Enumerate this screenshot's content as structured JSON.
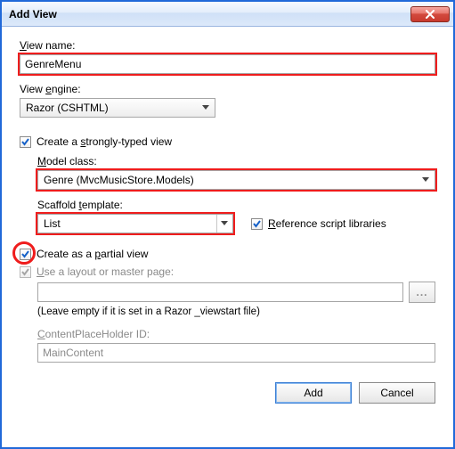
{
  "title": "Add View",
  "labels": {
    "view_name": "View name:",
    "view_name_u": "V",
    "view_engine": "View engine:",
    "view_engine_u": "e",
    "strongly_typed": "Create a strongly-typed view",
    "strongly_typed_u": "s",
    "model_class": "Model class:",
    "model_class_u": "M",
    "scaffold_template": "Scaffold template:",
    "scaffold_template_u": "t",
    "partial_view": "Create as a partial view",
    "partial_view_u": "p",
    "use_layout": "Use a layout or master page:",
    "use_layout_u": "U",
    "ref_scripts": "Reference script libraries",
    "ref_scripts_u": "R",
    "hint": "(Leave empty if it is set in a Razor _viewstart file)",
    "cph_id": "ContentPlaceHolder ID:",
    "cph_id_u": "C",
    "add": "Add",
    "cancel": "Cancel"
  },
  "values": {
    "view_name": "GenreMenu",
    "view_engine": "Razor (CSHTML)",
    "model_class": "Genre (MvcMusicStore.Models)",
    "scaffold_template": "List",
    "layout_path": "",
    "cph_id": "MainContent"
  },
  "checks": {
    "strongly_typed": true,
    "ref_scripts": true,
    "partial_view": true,
    "use_layout": true
  },
  "buttons": {
    "browse": "..."
  }
}
